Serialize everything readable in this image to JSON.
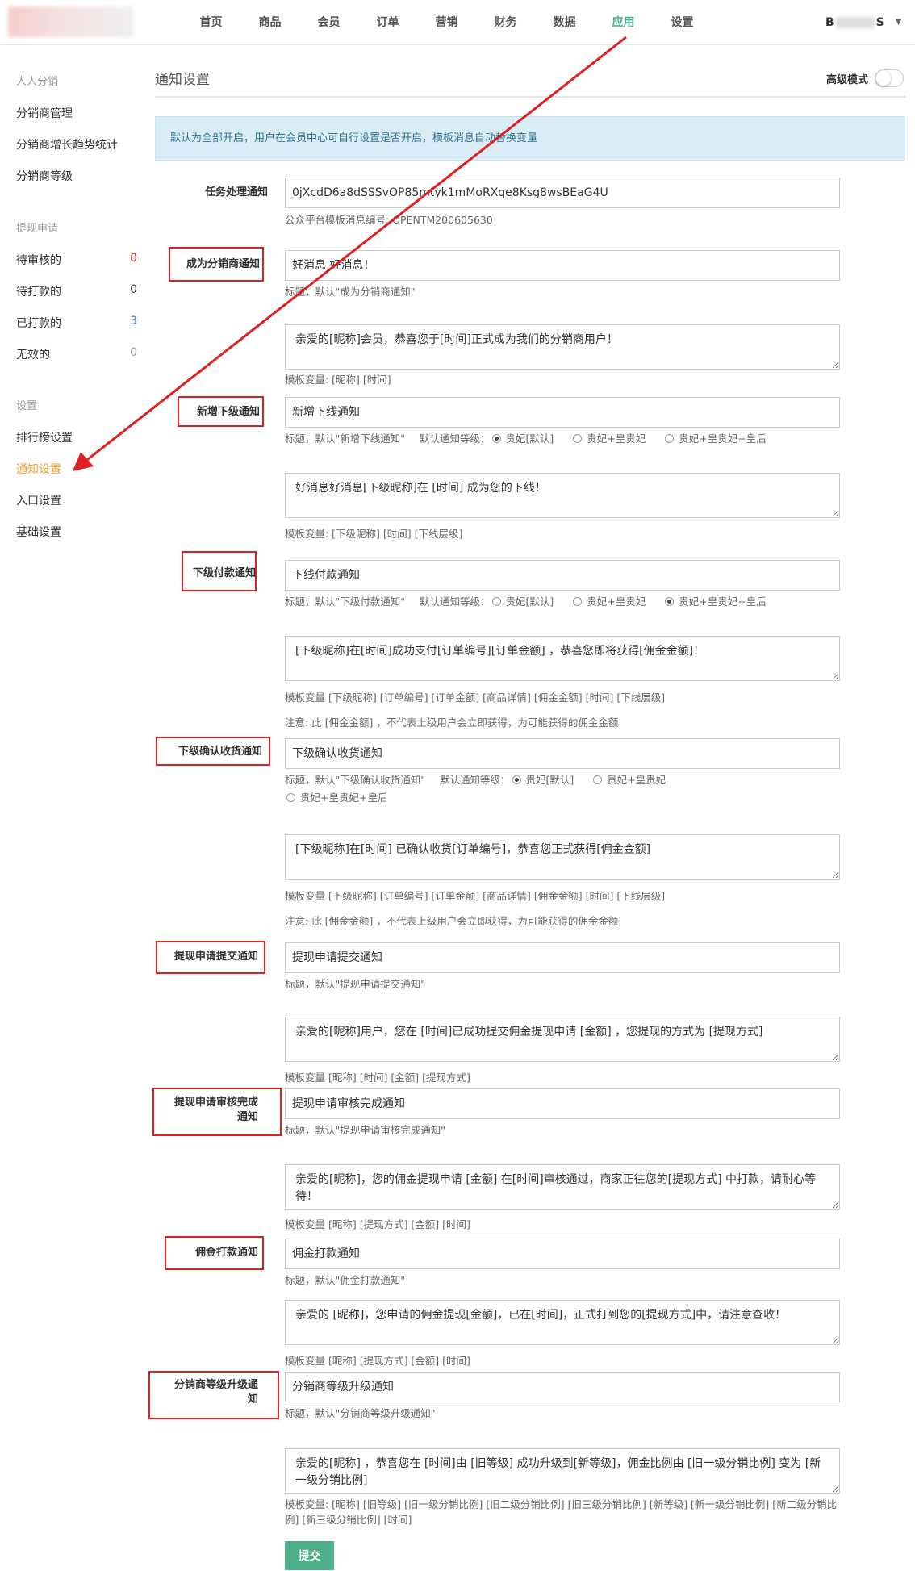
{
  "nav": {
    "items": [
      "首页",
      "商品",
      "会员",
      "订单",
      "营销",
      "财务",
      "数据",
      "应用",
      "设置"
    ],
    "active": "应用",
    "user_prefix": "B",
    "user_suffix": "S"
  },
  "sidebar": {
    "group1": "人人分销",
    "group1_items": [
      "分销商管理",
      "分销商增长趋势统计",
      "分销商等级"
    ],
    "group2": "提现申请",
    "group2_items": [
      {
        "label": "待审核的",
        "count": "0",
        "color": "#e02020"
      },
      {
        "label": "待打款的",
        "count": "0",
        "color": "#333333"
      },
      {
        "label": "已打款的",
        "count": "3",
        "color": "#3a7bd5"
      },
      {
        "label": "无效的",
        "count": "0",
        "color": "#999999"
      }
    ],
    "group3": "设置",
    "group3_items": [
      "排行榜设置",
      "通知设置",
      "入口设置",
      "基础设置"
    ],
    "active": "通知设置"
  },
  "main": {
    "title": "通知设置",
    "advanced_mode": "高级模式",
    "notice": "默认为全部开启，用户在会员中心可自行设置是否开启，模板消息自动替换变量",
    "task": {
      "label": "任务处理通知",
      "value": "0jXcdD6a8dSSSvOP85mtyk1mMoRXqe8Ksg8wsBEaG4U",
      "help": "公众平台模板消息编号: OPENTM200605630"
    },
    "become": {
      "label": "成为分销商通知",
      "title_value": "好消息 好消息！",
      "title_help": "标题，默认\"成为分销商通知\"",
      "content": "亲爱的[昵称]会员，恭喜您于[时间]正式成为我们的分销商用户！",
      "vars": "模板变量: [昵称] [时间]"
    },
    "newdown": {
      "label": "新增下级通知",
      "title_value": "新增下线通知",
      "title_help": "标题，默认\"新增下线通知\"",
      "level_label": "默认通知等级：",
      "options": [
        "贵妃[默认]",
        "贵妃+皇贵妃",
        "贵妃+皇贵妃+皇后"
      ],
      "selected": 0,
      "content": "好消息好消息[下级昵称]在 [时间] 成为您的下线！",
      "vars": "模板变量: [下级昵称] [时间] [下线层级]"
    },
    "downpay": {
      "label": "下级付款通知",
      "title_value": "下线付款通知",
      "title_help": "标题，默认\"下级付款通知\"",
      "level_label": "默认通知等级：",
      "options": [
        "贵妃[默认]",
        "贵妃+皇贵妃",
        "贵妃+皇贵妃+皇后"
      ],
      "selected": 2,
      "content": "[下级昵称]在[时间]成功支付[订单编号][订单金额] ，恭喜您即将获得[佣金金额]！",
      "vars": "模板变量 [下级昵称] [订单编号] [订单金额] [商品详情] [佣金金额] [时间] [下线层级]",
      "note": "注意: 此 [佣金金额] ，不代表上级用户会立即获得，为可能获得的佣金金额"
    },
    "downconfirm": {
      "label": "下级确认收货通知",
      "title_value": "下级确认收货通知",
      "title_help": "标题，默认\"下级确认收货通知\"",
      "level_label": "默认通知等级：",
      "options": [
        "贵妃[默认]",
        "贵妃+皇贵妃",
        "贵妃+皇贵妃+皇后"
      ],
      "selected": 0,
      "content": "[下级昵称]在[时间] 已确认收货[订单编号]，恭喜您正式获得[佣金金额]",
      "vars": "模板变量 [下级昵称] [订单编号] [订单金额] [商品详情] [佣金金额] [时间] [下线层级]",
      "note": "注意: 此 [佣金金额] ，不代表上级用户会立即获得，为可能获得的佣金金额"
    },
    "withdraw_submit": {
      "label": "提现申请提交通知",
      "title_value": "提现申请提交通知",
      "title_help": "标题，默认\"提现申请提交通知\"",
      "content": "亲爱的[昵称]用户，您在 [时间]已成功提交佣金提现申请 [金额] ，您提现的方式为 [提现方式]",
      "vars": "模板变量 [昵称] [时间] [金额] [提现方式]"
    },
    "withdraw_done": {
      "label_line1": "提现申请审核完成",
      "label_line2": "通知",
      "title_value": "提现申请审核完成通知",
      "title_help": "标题，默认\"提现申请审核完成通知\"",
      "content": "亲爱的[昵称]，您的佣金提现申请 [金额] 在[时间]审核通过，商家正往您的[提现方式] 中打款，请耐心等待！",
      "vars": "模板变量 [昵称] [提现方式] [金额] [时间]"
    },
    "commission_pay": {
      "label": "佣金打款通知",
      "title_value": "佣金打款通知",
      "title_help": "标题，默认\"佣金打款通知\"",
      "content": "亲爱的 [昵称]，您申请的佣金提现[金额]，已在[时间]，正式打到您的[提现方式]中，请注意查收！",
      "vars": "模板变量 [昵称] [提现方式] [金额] [时间]"
    },
    "level_up": {
      "label_line1": "分销商等级升级通",
      "label_line2": "知",
      "title_value": "分销商等级升级通知",
      "title_help": "标题，默认\"分销商等级升级通知\"",
      "content": "亲爱的[昵称] ，恭喜您在 [时间]由 [旧等级] 成功升级到[新等级]，佣金比例由 [旧一级分销比例] 变为 [新一级分销比例]",
      "vars": "模板变量: [昵称] [旧等级] [旧一级分销比例] [旧二级分销比例] [旧三级分销比例] [新等级] [新一级分销比例] [新二级分销比例] [新三级分销比例] [时间]"
    },
    "submit": "提交"
  },
  "colors": {
    "accent": "#43b08b",
    "annotation": "#e02020",
    "active_side": "#f0a030",
    "notice_bg": "#d9edf7"
  }
}
